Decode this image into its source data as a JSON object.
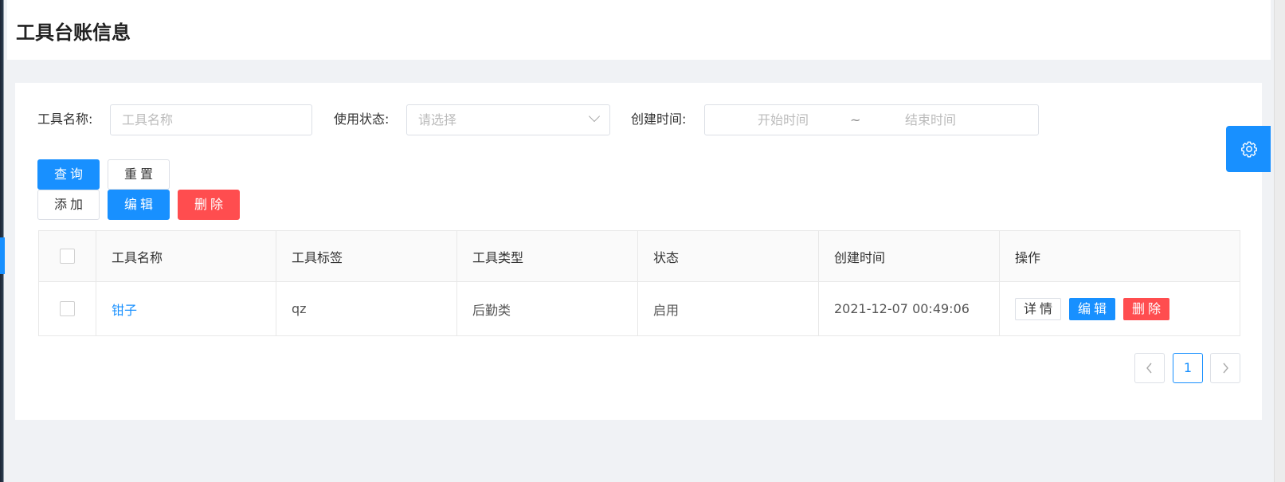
{
  "page": {
    "title": "工具台账信息"
  },
  "search": {
    "name_label": "工具名称:",
    "name_placeholder": "工具名称",
    "status_label": "使用状态:",
    "status_placeholder": "请选择",
    "created_label": "创建时间:",
    "start_placeholder": "开始时间",
    "range_separator": "~",
    "end_placeholder": "结束时间"
  },
  "toolbar": {
    "query": "查询",
    "reset": "重置",
    "add": "添加",
    "edit": "编辑",
    "delete": "删除"
  },
  "table": {
    "columns": [
      "工具名称",
      "工具标签",
      "工具类型",
      "状态",
      "创建时间",
      "操作"
    ],
    "rows": [
      {
        "name": "钳子",
        "tag": "qz",
        "type": "后勤类",
        "status": "启用",
        "created": "2021-12-07 00:49:06",
        "actions": {
          "detail": "详情",
          "edit": "编辑",
          "delete": "删除"
        }
      }
    ]
  },
  "pagination": {
    "prev": "‹",
    "current": "1",
    "next": "›"
  },
  "icons": {
    "settings": "gear-icon"
  },
  "colors": {
    "primary": "#1890ff",
    "danger": "#ff4d4f"
  }
}
